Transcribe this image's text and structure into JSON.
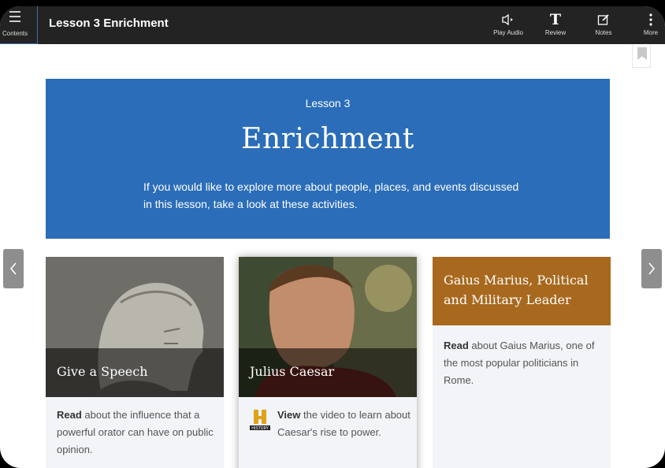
{
  "topbar": {
    "contents_label": "Contents",
    "title": "Lesson 3 Enrichment",
    "tools": [
      {
        "label": "Play Audio",
        "icon": "audio-icon"
      },
      {
        "label": "Review",
        "icon": "text-t-icon"
      },
      {
        "label": "Notes",
        "icon": "notes-icon"
      },
      {
        "label": "More",
        "icon": "more-vertical-icon"
      }
    ]
  },
  "banner": {
    "kicker": "Lesson 3",
    "heading": "Enrichment",
    "description": "If you would like to explore more about people, places, and events discussed in this lesson, take a look at these activities."
  },
  "cards": [
    {
      "caption": "Give a Speech",
      "verb": "Read",
      "text": " about the influence that a powerful orator can have on public opinion."
    },
    {
      "caption": "Julius Caesar",
      "verb": "View",
      "text": " the video to learn about Caesar's rise to power.",
      "logo_text": "HISTORY"
    },
    {
      "heading": "Gaius Marius, Political and Military Leader",
      "verb": "Read",
      "text": " about Gaius Marius, one of the most popular politicians in Rome."
    }
  ],
  "colors": {
    "topbar": "#232323",
    "banner": "#2b6db8",
    "card3_header": "#a8691e",
    "card_bg": "#f3f4f8"
  }
}
